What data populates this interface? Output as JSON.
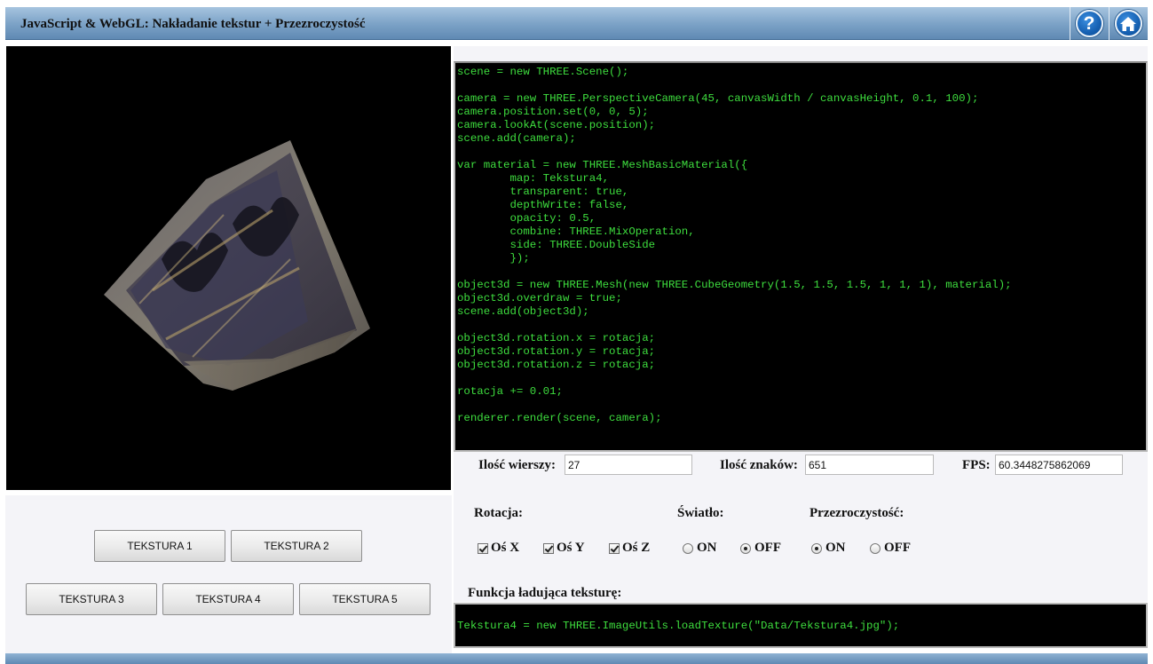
{
  "header": {
    "title": "JavaScript & WebGL: Nakładanie tekstur + Przezroczystość",
    "help_icon": "help-icon",
    "home_icon": "home-icon",
    "help_glyph": "?",
    "home_glyph": "⌂"
  },
  "code": {
    "lines": [
      "scene = new THREE.Scene();",
      "",
      "camera = new THREE.PerspectiveCamera(45, canvasWidth / canvasHeight, 0.1, 100);",
      "camera.position.set(0, 0, 5);",
      "camera.lookAt(scene.position);",
      "scene.add(camera);",
      "",
      "var material = new THREE.MeshBasicMaterial({",
      "        map: Tekstura4,",
      "        transparent: true,",
      "        depthWrite: false,",
      "        opacity: 0.5,",
      "        combine: THREE.MixOperation,",
      "        side: THREE.DoubleSide",
      "        });",
      "",
      "object3d = new THREE.Mesh(new THREE.CubeGeometry(1.5, 1.5, 1.5, 1, 1, 1), material);",
      "object3d.overdraw = true;",
      "scene.add(object3d);",
      "",
      "object3d.rotation.x = rotacja;",
      "object3d.rotation.y = rotacja;",
      "object3d.rotation.z = rotacja;",
      "",
      "rotacja += 0.01;",
      "",
      "renderer.render(scene, camera);"
    ],
    "text_color": "#3ede3e"
  },
  "stats": {
    "rows_label": "Ilość wierszy:",
    "rows_value": "27",
    "chars_label": "Ilość znaków:",
    "chars_value": "651",
    "fps_label": "FPS:",
    "fps_value": "60.3448275862069"
  },
  "textures": {
    "buttons": [
      "TEKSTURA 1",
      "TEKSTURA 2",
      "TEKSTURA 3",
      "TEKSTURA 4",
      "TEKSTURA 5"
    ]
  },
  "options": {
    "rotation": {
      "label": "Rotacja:",
      "x_label": "Oś X",
      "x_checked": true,
      "y_label": "Oś Y",
      "y_checked": true,
      "z_label": "Oś Z",
      "z_checked": true
    },
    "light": {
      "label": "Światło:",
      "on_label": "ON",
      "off_label": "OFF",
      "selected": "OFF"
    },
    "transparency": {
      "label": "Przezroczystość:",
      "on_label": "ON",
      "off_label": "OFF",
      "selected": "ON"
    }
  },
  "loader": {
    "label": "Funkcja ładująca teksturę:",
    "code": "Tekstura4 = new THREE.ImageUtils.loadTexture(\"Data/Tekstura4.jpg\");"
  },
  "colors": {
    "header_gradient_top": "#a6c4df",
    "header_gradient_bottom": "#5f89b3",
    "code_background": "#000000",
    "panel_background": "#f4f4f8"
  }
}
